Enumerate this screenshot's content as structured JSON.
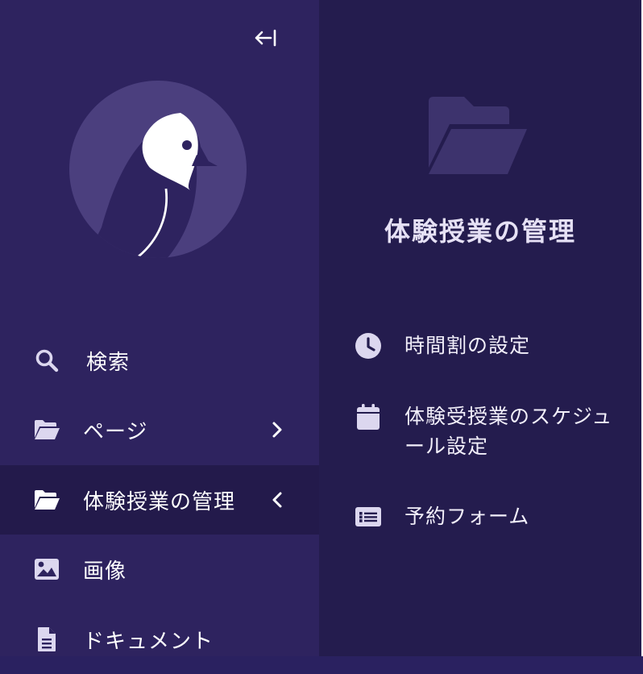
{
  "sidebar": {
    "collapse_icon": "arrow-left-to-line-icon",
    "logo_icon": "bird-logo-icon",
    "items": [
      {
        "label": "検索",
        "icon": "search-icon"
      },
      {
        "label": "ページ",
        "icon": "folder-open-icon"
      },
      {
        "label": "体験授業の管理",
        "icon": "folder-open-icon",
        "active": true
      },
      {
        "label": "画像",
        "icon": "image-icon"
      },
      {
        "label": "ドキュメント",
        "icon": "document-icon"
      }
    ]
  },
  "panel": {
    "title": "体験授業の管理",
    "header_icon": "folder-open-icon",
    "items": [
      {
        "label": "時間割の設定",
        "icon": "clock-icon"
      },
      {
        "label": "体験受授業のスケジュール設定",
        "icon": "calendar-icon"
      },
      {
        "label": "予約フォーム",
        "icon": "list-form-icon"
      }
    ]
  },
  "colors": {
    "sidebar_bg": "#2e235f",
    "active_bg": "#231a4b",
    "panel_bg": "#241c4e",
    "logo_circle": "#4b3f7e"
  }
}
